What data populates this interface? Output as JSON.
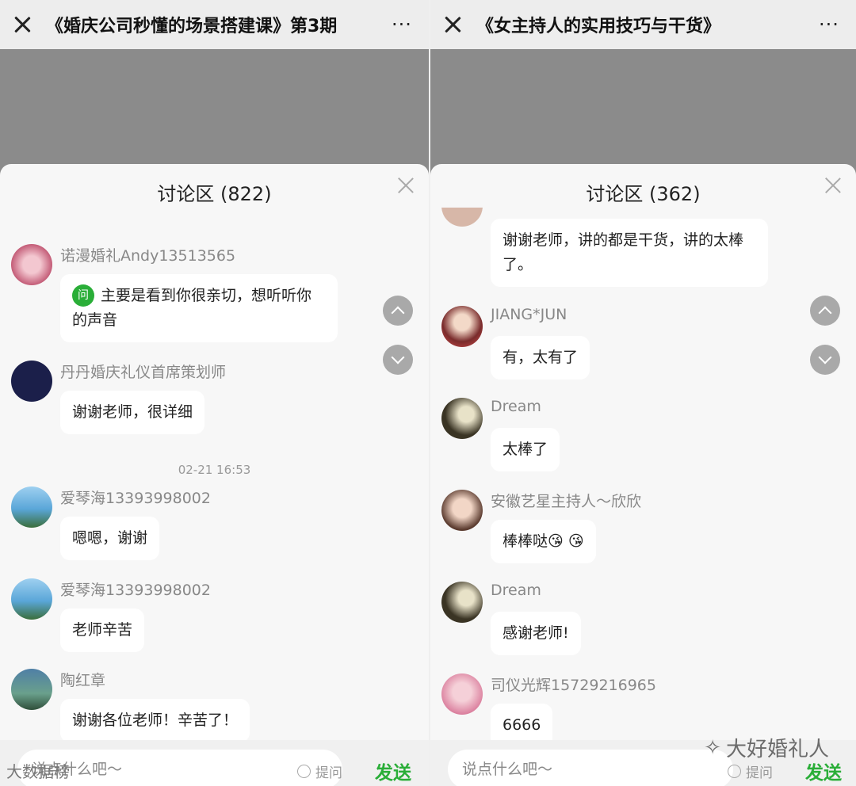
{
  "left": {
    "title": "《婚庆公司秒懂的场景搭建课》第3期",
    "more": "···",
    "sheet_title": "讨论区 (822)",
    "messages": [
      {
        "name": "诺漫婚礼Andy13513565",
        "badge": "问",
        "text": "主要是看到你很亲切，想听听你的声音"
      },
      {
        "name": "丹丹婚庆礼仪首席策划师",
        "text": "谢谢老师，很详细"
      },
      {
        "name": "爱琴海13393998002",
        "text": "嗯嗯，谢谢"
      },
      {
        "name": "爱琴海13393998002",
        "text": "老师辛苦"
      },
      {
        "name": "陶红章",
        "text": "谢谢各位老师！辛苦了！"
      }
    ],
    "timestamp": "02-21 16:53",
    "input_placeholder": "说点什么吧～",
    "ask_label": "提问",
    "send_label": "发送"
  },
  "right": {
    "title": "《女主持人的实用技巧与干货》",
    "more": "···",
    "sheet_title": "讨论区 (362)",
    "messages": [
      {
        "name": "",
        "text": "谢谢老师，讲的都是干货，讲的太棒了。"
      },
      {
        "name": "JIANG*JUN",
        "text": "有，太有了"
      },
      {
        "name": "Dream",
        "text": "太棒了"
      },
      {
        "name": "安徽艺星主持人～欣欣",
        "text": "棒棒哒😘 😘"
      },
      {
        "name": "Dream",
        "text": "感谢老师!"
      },
      {
        "name": "司仪光辉15729216965",
        "text": "6666"
      }
    ],
    "input_placeholder": "说点什么吧～",
    "ask_label": "提问",
    "send_label": "发送"
  },
  "watermark": "大好婚礼人",
  "watermark_left": "大数据榜",
  "colors": {
    "accent_green": "#2aae38",
    "overlay_gray": "#8b8b8b"
  }
}
